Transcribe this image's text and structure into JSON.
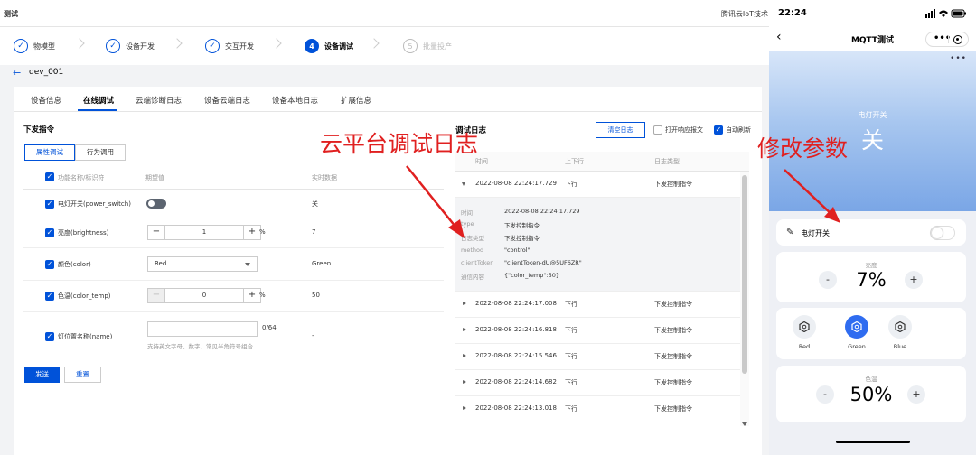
{
  "topbar": {
    "title": "测试",
    "brand": "腾讯云IoT技术"
  },
  "steps": [
    {
      "icon": "✓",
      "label": "物模型"
    },
    {
      "icon": "✓",
      "label": "设备开发"
    },
    {
      "icon": "✓",
      "label": "交互开发"
    },
    {
      "icon": "4",
      "label": "设备调试"
    },
    {
      "icon": "5",
      "label": "批量投产"
    }
  ],
  "device": {
    "name": "dev_001"
  },
  "tabs": [
    "设备信息",
    "在线调试",
    "云端诊断日志",
    "设备云端日志",
    "设备本地日志",
    "扩展信息"
  ],
  "command": {
    "title": "下发指令",
    "modes": [
      "属性调试",
      "行为调用"
    ],
    "headers": {
      "name": "功能名称/标识符",
      "expected": "期望值",
      "realtime": "实时数据"
    },
    "rows": [
      {
        "name": "电灯开关(power_switch)",
        "value": "关"
      },
      {
        "name": "亮度(brightness)",
        "input": "1",
        "unit": "%",
        "value": "7"
      },
      {
        "name": "颜色(color)",
        "select": "Red",
        "value": "Green"
      },
      {
        "name": "色温(color_temp)",
        "input": "0",
        "unit": "%",
        "value": "50"
      },
      {
        "name": "灯位置名称(name)",
        "counter": "0/64",
        "hint": "支持英文字母、数字、常见半角符号组合",
        "value": "-"
      }
    ],
    "send": "发送",
    "reset": "重置"
  },
  "log": {
    "title": "调试日志",
    "clear": "清空日志",
    "opt_response": "打开响应报文",
    "opt_refresh": "自动刷新",
    "headers": {
      "time": "时间",
      "direction": "上下行",
      "type": "日志类型"
    },
    "expanded": {
      "time": "2022-08-08 22:24:17.729",
      "direction": "下行",
      "type": "下发控制指令"
    },
    "detail": [
      {
        "k": "时间",
        "v": "2022-08-08 22:24:17.729"
      },
      {
        "k": "type",
        "v": "下发控制指令"
      },
      {
        "k": "日志类型",
        "v": "下发控制指令"
      },
      {
        "k": "method",
        "v": "\"control\""
      },
      {
        "k": "clientToken",
        "v": "\"clientToken-dU@5UF6ZR\""
      },
      {
        "k": "通信内容",
        "v": "{\"color_temp\":50}"
      }
    ],
    "rows": [
      {
        "time": "2022-08-08 22:24:17.008",
        "direction": "下行",
        "type": "下发控制指令"
      },
      {
        "time": "2022-08-08 22:24:16.818",
        "direction": "下行",
        "type": "下发控制指令"
      },
      {
        "time": "2022-08-08 22:24:15.546",
        "direction": "下行",
        "type": "下发控制指令"
      },
      {
        "time": "2022-08-08 22:24:14.682",
        "direction": "下行",
        "type": "下发控制指令"
      },
      {
        "time": "2022-08-08 22:24:13.018",
        "direction": "下行",
        "type": "下发控制指令"
      }
    ]
  },
  "annotations": {
    "cloud_log": "云平台调试日志",
    "modify_params": "修改参数"
  },
  "phone": {
    "time": "22:24",
    "title": "MQTT测试",
    "more": "•••",
    "hero_label": "电灯开关",
    "hero_value": "关",
    "switch_label": "电灯开关",
    "brightness_label": "亮度",
    "brightness_value": "7%",
    "colors": [
      "Red",
      "Green",
      "Blue"
    ],
    "selected_color": "Green",
    "colortemp_label": "色温",
    "colortemp_value": "50%",
    "minus": "-",
    "plus": "+"
  },
  "colors": {
    "accent": "#0052d9",
    "annotation": "#e02020",
    "phone_accent": "#2f6cf0"
  }
}
